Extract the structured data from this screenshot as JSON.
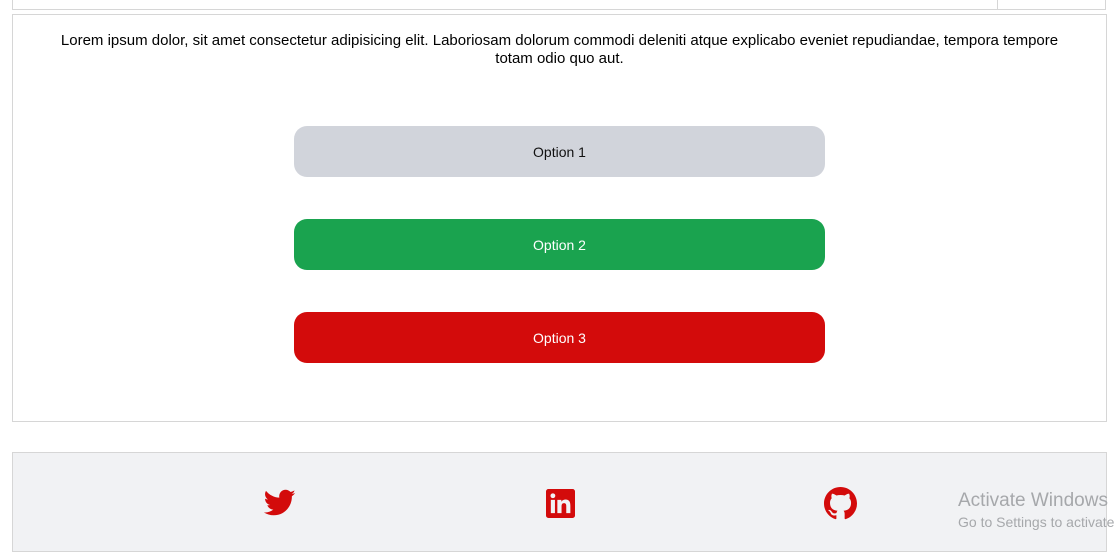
{
  "content": {
    "description": "Lorem ipsum dolor, sit amet consectetur adipisicing elit. Laboriosam dolorum commodi deleniti atque explicabo eveniet repudiandae, tempora tempore totam odio quo aut."
  },
  "options": [
    {
      "label": "Option 1",
      "bg": "#d1d4db",
      "fg": "#111111"
    },
    {
      "label": "Option 2",
      "bg": "#1aa34f",
      "fg": "#ffffff"
    },
    {
      "label": "Option 3",
      "bg": "#d30b0b",
      "fg": "#ffffff"
    }
  ],
  "footer": {
    "icon_color": "#d30b0b",
    "icons": [
      "twitter-icon",
      "linkedin-icon",
      "github-icon"
    ]
  },
  "watermark": {
    "title": "Activate Windows",
    "subtitle": "Go to Settings to activate Windows."
  }
}
